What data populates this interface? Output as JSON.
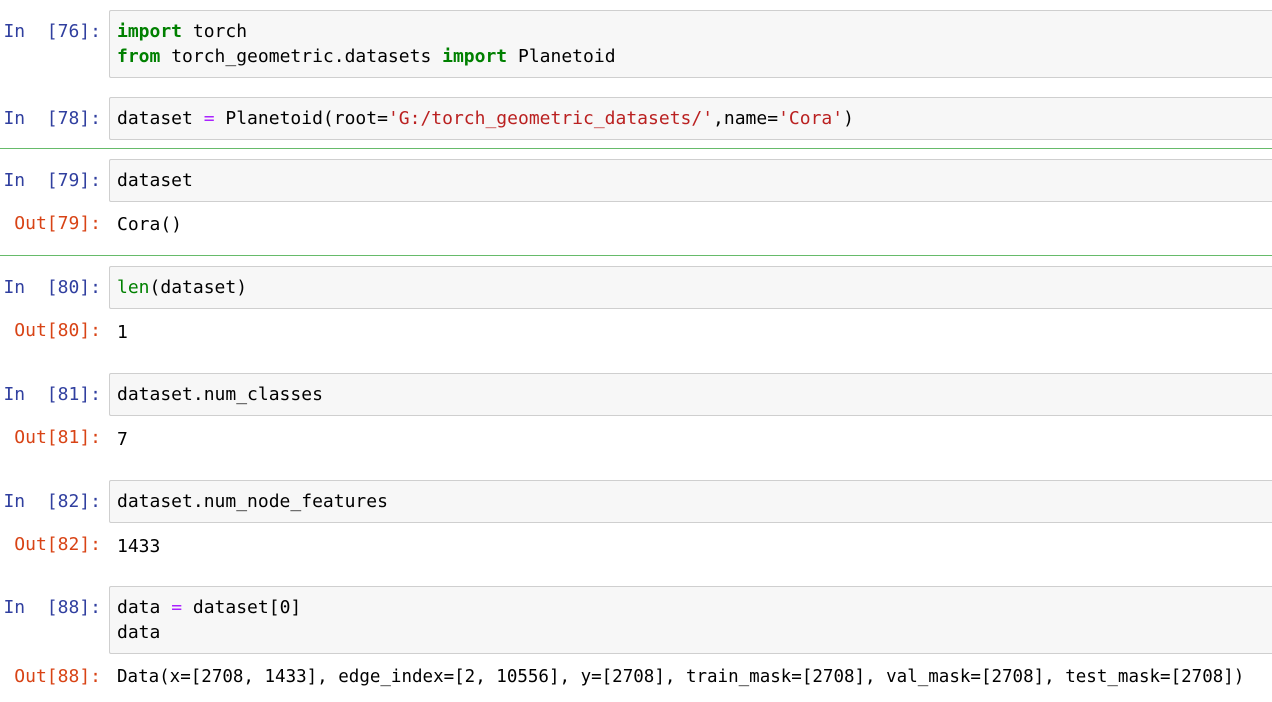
{
  "cells": {
    "c76": {
      "in_prompt": "In  [76]:",
      "line1": {
        "kw1": "import",
        "rest1": " torch"
      },
      "line2": {
        "kw1": "from",
        "mid": " torch_geometric.datasets ",
        "kw2": "import",
        "rest": " Planetoid"
      }
    },
    "c78": {
      "in_prompt": "In  [78]:",
      "p1": "dataset ",
      "op1": "=",
      "p2": " Planetoid(root=",
      "str1": "'G:/torch_geometric_datasets/'",
      "p3": ",name=",
      "str2": "'Cora'",
      "p4": ")"
    },
    "c79": {
      "in_prompt": "In  [79]:",
      "code": "dataset",
      "out_prompt": "Out[79]:",
      "output": "Cora()"
    },
    "c80": {
      "in_prompt": "In  [80]:",
      "builtin": "len",
      "rest": "(dataset)",
      "out_prompt": "Out[80]:",
      "output": "1"
    },
    "c81": {
      "in_prompt": "In  [81]:",
      "code": "dataset.num_classes",
      "out_prompt": "Out[81]:",
      "output": "7"
    },
    "c82": {
      "in_prompt": "In  [82]:",
      "code": "dataset.num_node_features",
      "out_prompt": "Out[82]:",
      "output": "1433"
    },
    "c88": {
      "in_prompt": "In  [88]:",
      "p1": "data ",
      "op1": "=",
      "p2": " dataset[0]",
      "line2": "data",
      "out_prompt": "Out[88]:",
      "output": "Data(x=[2708, 1433], edge_index=[2, 10556], y=[2708], train_mask=[2708], val_mask=[2708], test_mask=[2708])"
    }
  },
  "colors": {
    "in_prompt": "#303f9f",
    "out_prompt": "#d84315",
    "keyword": "#008000",
    "string": "#ba2121",
    "operator": "#aa22ff",
    "selection_border": "#66bb6a"
  }
}
